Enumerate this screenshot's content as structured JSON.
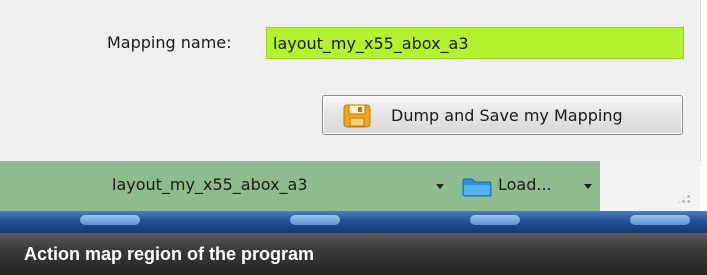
{
  "mapping": {
    "label": "Mapping name:",
    "value": "layout_my_x55_abox_a3"
  },
  "dump_button": {
    "label": "Dump and Save my Mapping",
    "icon": "floppy-disk-icon"
  },
  "action_map": {
    "selected_map": "layout_my_x55_abox_a3",
    "load_label": "Load...",
    "load_icon": "folder-icon"
  },
  "caption": {
    "text": "Action map region of the program"
  },
  "colors": {
    "mapping_field_bg": "#b4f12f",
    "status_strip_bg": "#8fbc8f",
    "taskbar_blue": "#245096",
    "caption_bg": "#2f2f2f"
  }
}
